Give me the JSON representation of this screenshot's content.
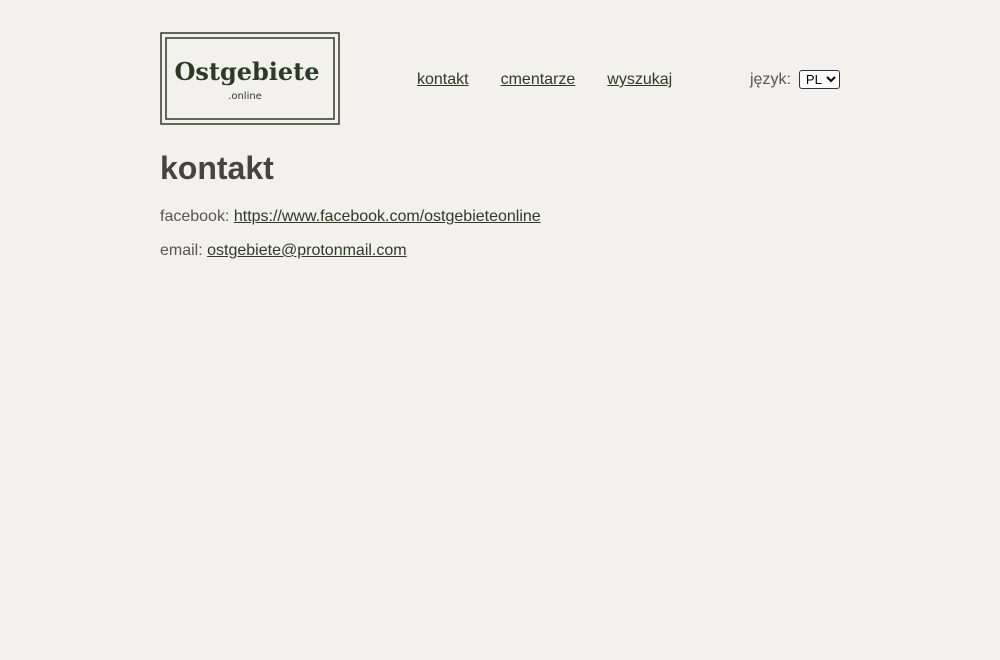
{
  "logo": {
    "title": "Ostgebiete",
    "subtitle": ".online",
    "color": "#2e3b24"
  },
  "nav": {
    "items": [
      {
        "label": "kontakt"
      },
      {
        "label": "cmentarze"
      },
      {
        "label": "wyszukaj"
      }
    ]
  },
  "language": {
    "label": "język:",
    "selected": "PL"
  },
  "main": {
    "title": "kontakt",
    "facebook": {
      "label": "facebook:",
      "link": "https://www.facebook.com/ostgebieteonline"
    },
    "email": {
      "label": "email:",
      "link": "ostgebiete@protonmail.com"
    }
  },
  "colors": {
    "background": "#f2f1ed",
    "accent": "#2e3b24",
    "text": "#4a4a4a"
  }
}
